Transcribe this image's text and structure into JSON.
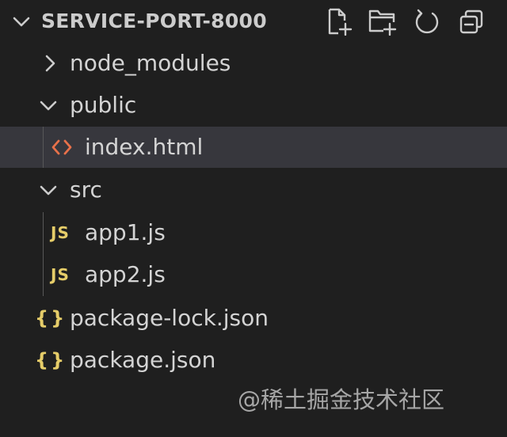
{
  "explorer": {
    "title": "SERVICE-PORT-8000",
    "actions": [
      {
        "name": "new-file",
        "icon": "new-file-icon"
      },
      {
        "name": "new-folder",
        "icon": "new-folder-icon"
      },
      {
        "name": "refresh",
        "icon": "refresh-icon"
      },
      {
        "name": "collapse-all",
        "icon": "collapse-all-icon"
      }
    ],
    "tree": [
      {
        "label": "node_modules",
        "type": "folder",
        "expanded": false,
        "depth": 0
      },
      {
        "label": "public",
        "type": "folder",
        "expanded": true,
        "depth": 0
      },
      {
        "label": "index.html",
        "type": "html",
        "depth": 1,
        "selected": true,
        "icon_text": "<>"
      },
      {
        "label": "src",
        "type": "folder",
        "expanded": true,
        "depth": 0
      },
      {
        "label": "app1.js",
        "type": "js",
        "depth": 1,
        "icon_text": "JS"
      },
      {
        "label": "app2.js",
        "type": "js",
        "depth": 1,
        "icon_text": "JS"
      },
      {
        "label": "package-lock.json",
        "type": "json",
        "depth": 0,
        "icon_text": "{}"
      },
      {
        "label": "package.json",
        "type": "json",
        "depth": 0,
        "icon_text": "{}"
      }
    ]
  },
  "colors": {
    "background": "#1f1f1f",
    "selected_row": "#37373d",
    "text": "#d4d4d4",
    "html_icon": "#e8714a",
    "js_icon": "#e6cd69",
    "json_icon": "#e6cd69"
  },
  "watermark": "@稀土掘金技术社区"
}
